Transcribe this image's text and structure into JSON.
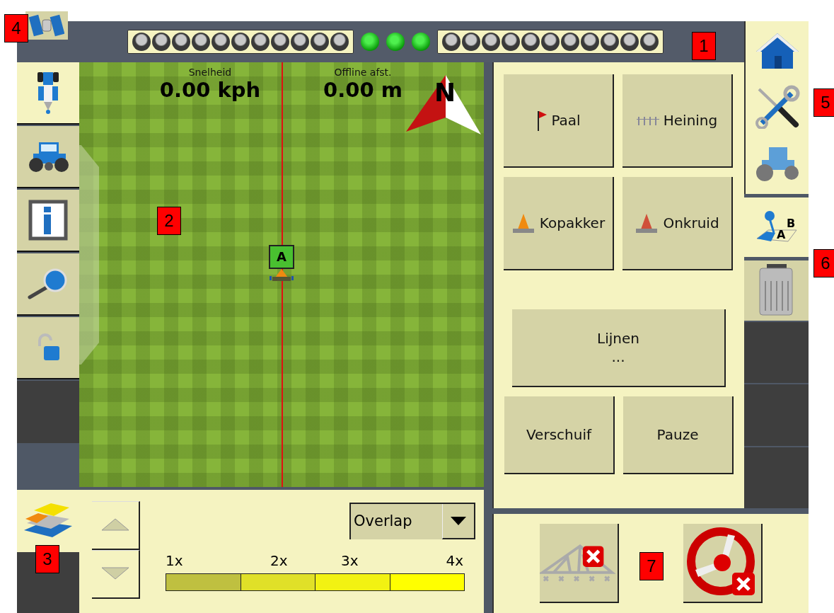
{
  "lightbar": {
    "left": [
      {
        "on": false
      },
      {
        "on": false
      },
      {
        "on": false
      },
      {
        "on": false
      },
      {
        "on": false
      },
      {
        "on": false
      },
      {
        "on": false
      },
      {
        "on": false
      },
      {
        "on": false
      },
      {
        "on": false
      },
      {
        "on": false
      }
    ],
    "center": [
      {
        "on": true
      },
      {
        "on": true
      },
      {
        "on": true
      }
    ],
    "right": [
      {
        "on": false
      },
      {
        "on": false
      },
      {
        "on": false
      },
      {
        "on": false
      },
      {
        "on": false
      },
      {
        "on": false
      },
      {
        "on": false
      },
      {
        "on": false
      },
      {
        "on": false
      },
      {
        "on": false
      },
      {
        "on": false
      }
    ]
  },
  "left_tabs": [
    {
      "kind": "implement",
      "selected": true
    },
    {
      "kind": "tractor",
      "selected": false
    },
    {
      "kind": "info",
      "selected": false
    },
    {
      "kind": "zoom",
      "selected": false
    },
    {
      "kind": "lock",
      "selected": false
    }
  ],
  "map": {
    "speed": {
      "label": "Snelheid",
      "value": "0.00 kph"
    },
    "offline": {
      "label": "Offline afst.",
      "value": "0.00 m"
    },
    "compass": "N",
    "vehicle_marker": "A"
  },
  "panel_buttons": [
    {
      "kind": "flag",
      "label": "Paal"
    },
    {
      "kind": "fence",
      "label": "Heining"
    },
    {
      "kind": "cone",
      "label": "Kopakker"
    },
    {
      "kind": "weed",
      "label": "Onkruid"
    },
    {
      "kind": "wide",
      "label": "Lijnen",
      "sublabel": "..."
    },
    {
      "kind": "plain",
      "label": "Verschuif"
    },
    {
      "kind": "plain",
      "label": "Pauze"
    }
  ],
  "right_tabs": [
    {
      "kind": "ab",
      "selected": true,
      "letters": [
        "A",
        "B"
      ]
    },
    {
      "kind": "module",
      "selected": false
    }
  ],
  "coverage": {
    "mode": "Overlap",
    "scale": [
      {
        "label": "1x",
        "color": "#bfc040"
      },
      {
        "label": "2x",
        "color": "#e0e028"
      },
      {
        "label": "3x",
        "color": "#f2f212"
      },
      {
        "label": "4x",
        "color": "#ffff00"
      }
    ]
  },
  "callouts": [
    "1",
    "2",
    "3",
    "4",
    "5",
    "6",
    "7"
  ]
}
